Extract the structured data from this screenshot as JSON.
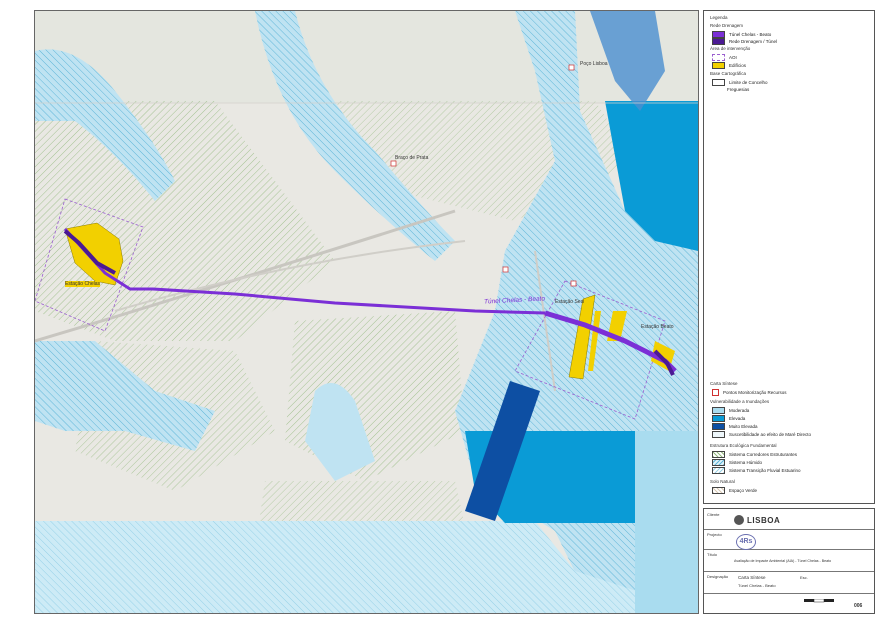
{
  "map": {
    "tunnel_label": "Túnel Chelas - Beato",
    "labels": [
      {
        "id": "chelas",
        "text": "Estação Chelas"
      },
      {
        "id": "beato",
        "text": "Estação Beato"
      },
      {
        "id": "braco",
        "text": "Braço de Prata"
      },
      {
        "id": "poco",
        "text": "Poço Lisboa"
      },
      {
        "id": "sesi",
        "text": "Estação Sesi"
      }
    ],
    "colors": {
      "tunnel": "#7b2fd6",
      "tunnel_dark": "#4b1a93",
      "building": "#f2d000",
      "high_flood": "#0a9bd6",
      "very_high_flood": "#0d4fa3",
      "moderate_flood": "#a9dcef",
      "hatch_green": "#9bbf86",
      "aoi_dash": "#9b5fd0"
    }
  },
  "legend": {
    "title": "Legenda",
    "sections": [
      {
        "header": "Rede Drenagem",
        "items": [
          {
            "label": "Túnel Chelas - Beato",
            "swatch": "tunnel"
          },
          {
            "label": "Rede Drenagem / Túnel",
            "swatch": "tunnel_dark"
          }
        ]
      },
      {
        "header": "Área de intervenção",
        "items": [
          {
            "label": "AOI",
            "swatch": "aoi"
          },
          {
            "label": "Edifícios",
            "swatch": "building"
          }
        ]
      },
      {
        "header": "Base Cartográfica",
        "items": [
          {
            "label": "Limite de Concelho",
            "swatch": "limit"
          },
          {
            "label": "Freguesias",
            "swatch": "none"
          }
        ]
      },
      {
        "header": "Carta Síntese",
        "items": [
          {
            "label": "Pontos Monitorização Recursos",
            "swatch": "pin"
          }
        ]
      },
      {
        "header": "Vulnerabilidade a Inundações",
        "items": [
          {
            "label": "Moderada",
            "swatch": "moderate_flood"
          },
          {
            "label": "Elevada",
            "swatch": "high_flood"
          },
          {
            "label": "Muito Elevada",
            "swatch": "very_high_flood"
          },
          {
            "label": "Suscetibilidade ao efeito de Maré Directo",
            "swatch": "light"
          }
        ]
      },
      {
        "header": "Estrutura Ecológica Fundamental",
        "items": [
          {
            "label": "Sistema Corredores Estruturantes",
            "swatch": "hatch_green"
          },
          {
            "label": "Sistema Húmido",
            "swatch": "hatch_blue"
          },
          {
            "label": "Sistema Transição Fluvial Estuarino",
            "swatch": "hatch_light"
          }
        ]
      },
      {
        "header": "Solo Natural",
        "items": [
          {
            "label": "Espaço Verde",
            "swatch": "hatch_pale"
          }
        ]
      }
    ]
  },
  "titleblock": {
    "client_label": "Cliente",
    "logo_text": "LISBOA",
    "project_label": "Projecto",
    "rs_text": "4Rs",
    "title_label": "Título",
    "title_text": "Avaliação de Impacte Ambiental (AIA) - Túnel Chelas - Beato",
    "drawing_label": "Designação",
    "drawing_text": "Carta Síntese",
    "sheet_text": "Túnel Chelas - Beato",
    "scale_label": "Esc.",
    "sheet_no": "006"
  }
}
